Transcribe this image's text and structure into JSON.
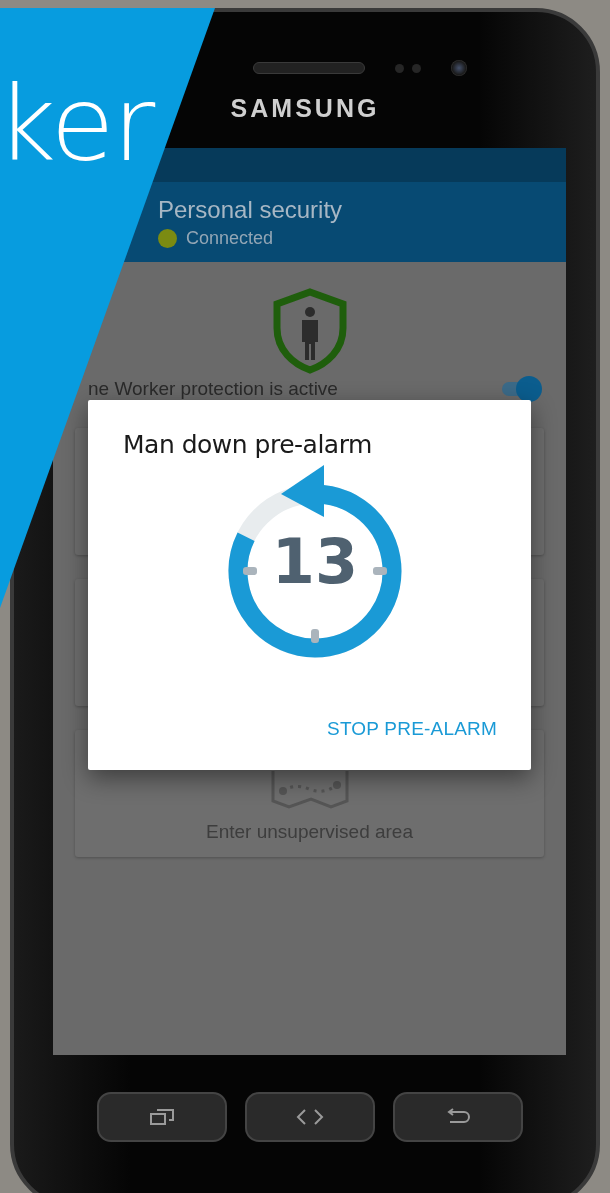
{
  "banner": {
    "text": "ker"
  },
  "device": {
    "brand": "SAMSUNG"
  },
  "app_bar": {
    "title": "Personal security",
    "status": {
      "label": "Connected",
      "color": "#7b8b12"
    }
  },
  "protection": {
    "label": "ne Worker protection is active",
    "on": true
  },
  "area_card": {
    "label": "Enter unsupervised area"
  },
  "dialog": {
    "title": "Man down pre-alarm",
    "countdown": {
      "value": "13"
    },
    "action": "STOP PRE-ALARM"
  }
}
